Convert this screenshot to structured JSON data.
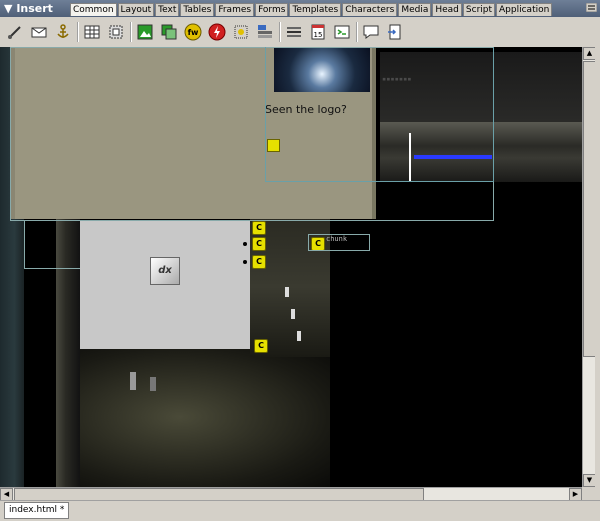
{
  "insert_panel": {
    "title": "Insert",
    "tabs": [
      "Common",
      "Layout",
      "Text",
      "Tables",
      "Frames",
      "Forms",
      "Templates",
      "Characters",
      "Media",
      "Head",
      "Script",
      "Application"
    ],
    "active_tab": "Common"
  },
  "toolbar_icons": [
    "hyperlink-icon",
    "email-link-icon",
    "named-anchor-icon",
    "table-icon",
    "layer-icon",
    "image-icon",
    "rollover-image-icon",
    "fireworks-html-icon",
    "flash-icon",
    "navigation-bar-icon",
    "tabular-data-icon",
    "horizontal-rule-icon",
    "date-icon",
    "tag-chooser-icon",
    "comment-icon",
    "server-side-include-icon"
  ],
  "document": {
    "caption": "Seen the logo?",
    "frame_text_1": "▪▪▪▪▪▪▪",
    "frame_text_2": "chunk",
    "logo_label": "dx",
    "marker_glyph": "C"
  },
  "status": {
    "file_tab": "index.html *"
  },
  "colors": {
    "header": "#4f5f78",
    "panel": "#d4d0c8",
    "doc_bg": "#000000",
    "tan_panel": "#9a9680",
    "gray_panel": "#c8c8c8",
    "marker": "#e6e000",
    "highlight_line": "#2a3aff"
  }
}
